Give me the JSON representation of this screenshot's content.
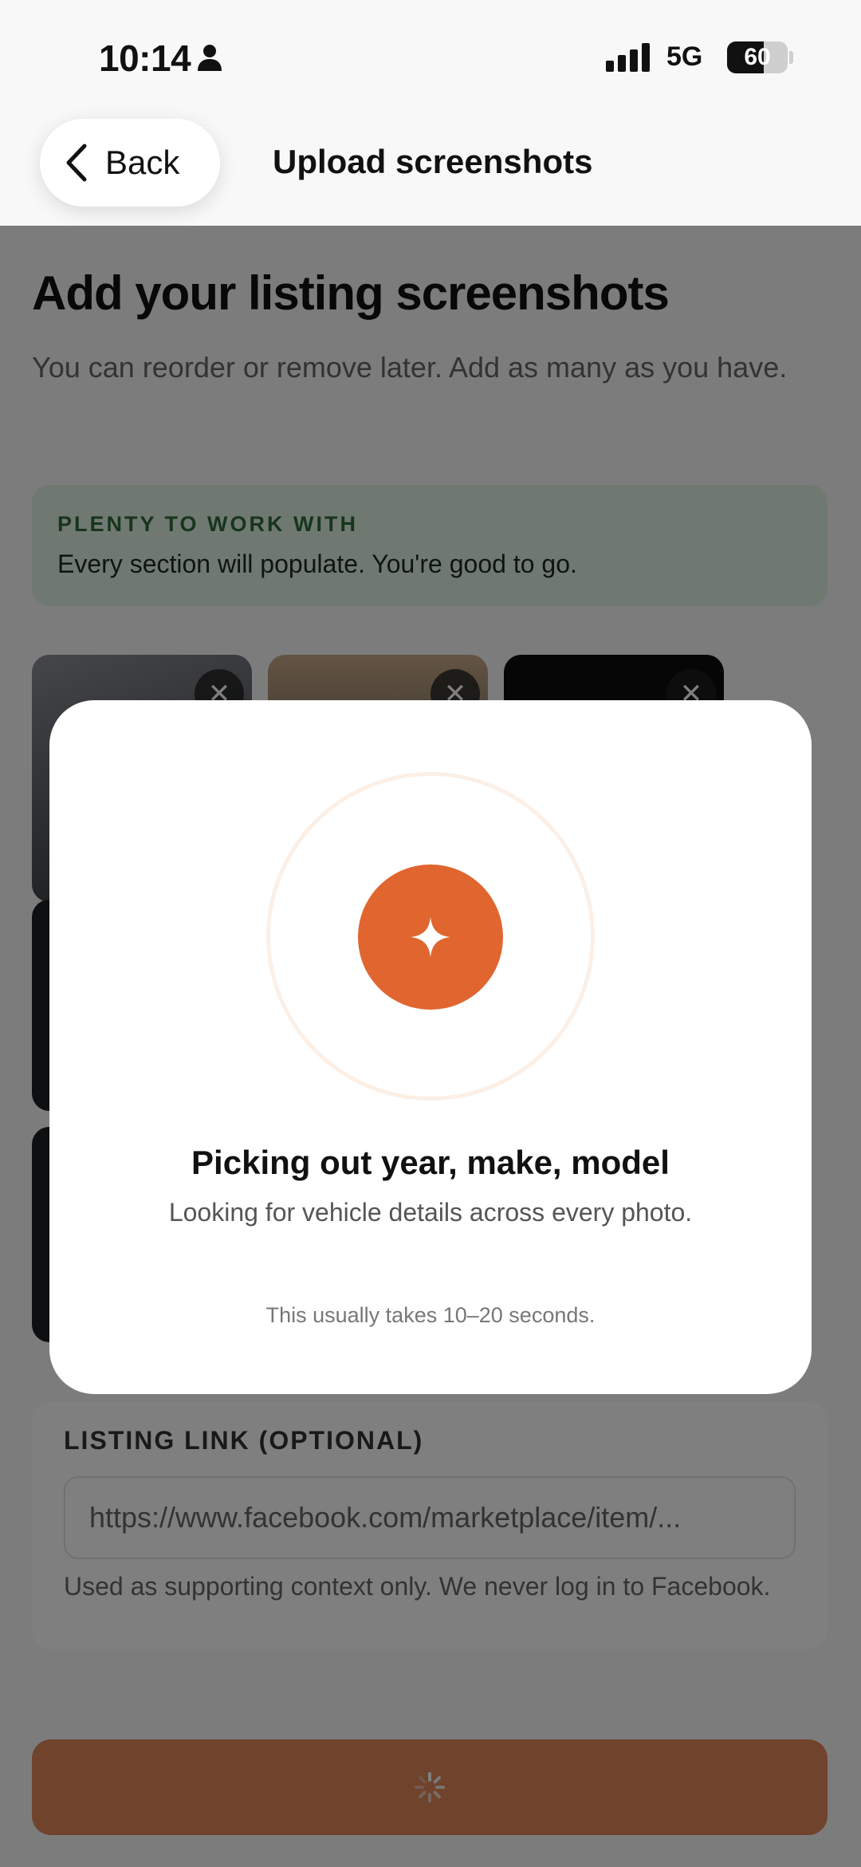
{
  "status_bar": {
    "time": "10:14",
    "network": "5G",
    "battery": "60",
    "battery_level": 0.6
  },
  "nav": {
    "back_label": "Back",
    "title": "Upload screenshots"
  },
  "main": {
    "title": "Add your listing screenshots",
    "subtitle": "You can reorder or remove later. Add as many as you have.",
    "status_card": {
      "title": "PLENTY TO WORK WITH",
      "text": "Every section will populate. You're good to go."
    },
    "thumb_close": "✕",
    "link_card": {
      "label": "LISTING LINK (OPTIONAL)",
      "placeholder": "https://www.facebook.com/marketplace/item/...",
      "help": "Used as supporting context only. We never log in to Facebook."
    }
  },
  "modal": {
    "title": "Picking out year, make, model",
    "subtitle": "Looking for vehicle details across every photo.",
    "note": "This usually takes 10–20 seconds.",
    "icon": "sparkle-icon"
  },
  "colors": {
    "accent": "#e0652f",
    "success_bg": "#dff3e2",
    "success_text": "#2f6b3a"
  }
}
